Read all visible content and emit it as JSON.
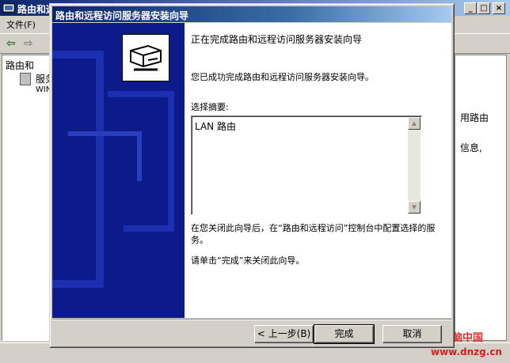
{
  "background_window": {
    "title": "路由和远",
    "menu_file": "文件(F)",
    "caption_buttons": [
      "_",
      "□",
      "×"
    ],
    "tree_items": [
      "路由和",
      "服务",
      "WIN"
    ],
    "right_text": [
      "用路由",
      "信息,"
    ]
  },
  "wizard": {
    "title": "路由和远程访问服务器安装向导",
    "heading": "正在完成路由和远程访问服务器安装向导",
    "success_text": "您已成功完成路由和远程访问服务器安装向导。",
    "summary_label": "选择摘要:",
    "summary_value": "LAN 路由",
    "after_close_text": "在您关闭此向导后，在“路由和远程访问”控制台中配置选择的服务。",
    "finish_hint": "请单击“完成”来关闭此向导。",
    "buttons": {
      "back": "< 上一步(B)",
      "finish": "完成",
      "cancel": "取消"
    }
  },
  "watermark": {
    "name": "电脑中国",
    "url": "www.dnzg.cn"
  },
  "colors": {
    "title_bar": "#0a246a",
    "banner": "#0d1a8a",
    "face": "#d4d0c8"
  },
  "icons": [
    "mmc-app-icon",
    "back-arrow-icon",
    "forward-arrow-icon",
    "server-icon",
    "wizard-network-icon",
    "scroll-up-icon",
    "scroll-down-icon"
  ]
}
